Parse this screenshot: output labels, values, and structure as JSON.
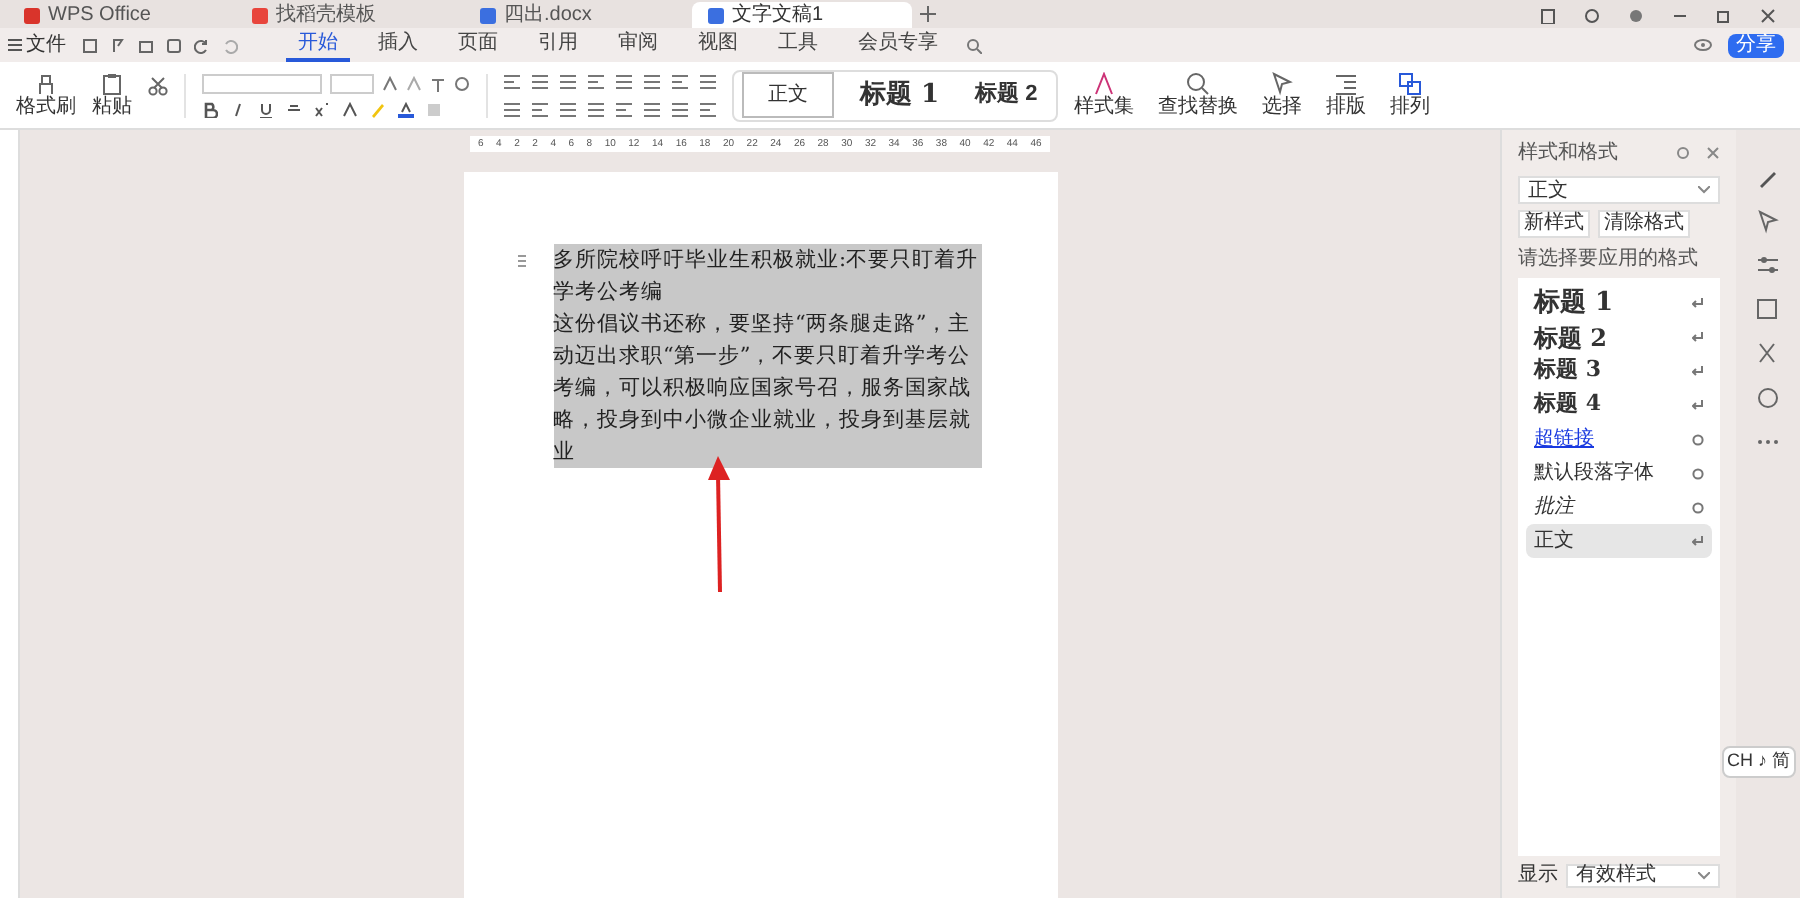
{
  "title_tabs": [
    {
      "label": "WPS Office",
      "kind": "app",
      "selected": false
    },
    {
      "label": "找稻壳模板",
      "kind": "template",
      "selected": false
    },
    {
      "label": "四出.docx",
      "kind": "doc",
      "selected": false
    },
    {
      "label": "文字文稿1",
      "kind": "doc",
      "selected": true
    }
  ],
  "menu": {
    "file": "文件",
    "tabs": [
      {
        "label": "开始",
        "selected": true
      },
      {
        "label": "插入",
        "selected": false
      },
      {
        "label": "页面",
        "selected": false
      },
      {
        "label": "引用",
        "selected": false
      },
      {
        "label": "审阅",
        "selected": false
      },
      {
        "label": "视图",
        "selected": false
      },
      {
        "label": "工具",
        "selected": false
      },
      {
        "label": "会员专享",
        "selected": false
      }
    ]
  },
  "share_button": "分享",
  "ribbon": {
    "paste_group": [
      "格式刷",
      "粘贴"
    ],
    "styles": [
      {
        "label": "正文",
        "kind": "body",
        "selected": true
      },
      {
        "label": "标题 1",
        "kind": "h1",
        "selected": false
      },
      {
        "label": "标题 2",
        "kind": "h2",
        "selected": false
      }
    ],
    "tools": [
      "样式集",
      "查找替换",
      "选择",
      "排版",
      "排列"
    ]
  },
  "ruler": [
    "6",
    "4",
    "2",
    "2",
    "4",
    "6",
    "8",
    "10",
    "12",
    "14",
    "16",
    "18",
    "20",
    "22",
    "24",
    "26",
    "28",
    "30",
    "32",
    "34",
    "36",
    "38",
    "40",
    "42",
    "44",
    "46"
  ],
  "document": {
    "selected": true,
    "paragraphs": [
      "多所院校呼吁毕业生积极就业:不要只盯着升学考公考编",
      "这份倡议书还称，要坚持“两条腿走路”，主动迈出求职“第一步”，不要只盯着升学考公考编，可以积极响应国家号召，服务国家战略，投身到中小微企业就业，投身到基层就业"
    ]
  },
  "styles_panel": {
    "title": "样式和格式",
    "current_style": "正文",
    "buttons": [
      "新样式",
      "清除格式"
    ],
    "hint": "请选择要应用的格式",
    "styles": [
      {
        "label": "标题 1",
        "kind": "h1",
        "selected": false
      },
      {
        "label": "标题 2",
        "kind": "h2",
        "selected": false
      },
      {
        "label": "标题 3",
        "kind": "h3",
        "selected": false
      },
      {
        "label": "标题 4",
        "kind": "h4",
        "selected": false
      },
      {
        "label": "超链接",
        "kind": "link",
        "selected": false
      },
      {
        "label": "默认段落字体",
        "kind": "char",
        "selected": false
      },
      {
        "label": "批注",
        "kind": "italic",
        "selected": false
      },
      {
        "label": "正文",
        "kind": "body",
        "selected": true
      }
    ],
    "show_label": "显示",
    "show_value": "有效样式"
  },
  "ime": "CH ♪ 简"
}
